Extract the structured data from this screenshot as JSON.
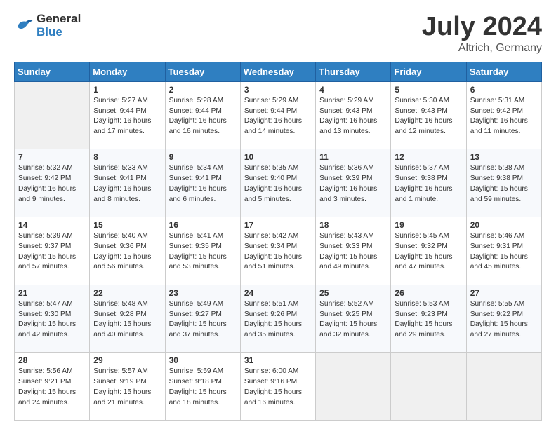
{
  "header": {
    "logo_line1": "General",
    "logo_line2": "Blue",
    "month": "July 2024",
    "location": "Altrich, Germany"
  },
  "days_of_week": [
    "Sunday",
    "Monday",
    "Tuesday",
    "Wednesday",
    "Thursday",
    "Friday",
    "Saturday"
  ],
  "weeks": [
    [
      {
        "day": "",
        "empty": true
      },
      {
        "day": "1",
        "sunrise": "Sunrise: 5:27 AM",
        "sunset": "Sunset: 9:44 PM",
        "daylight": "Daylight: 16 hours and 17 minutes."
      },
      {
        "day": "2",
        "sunrise": "Sunrise: 5:28 AM",
        "sunset": "Sunset: 9:44 PM",
        "daylight": "Daylight: 16 hours and 16 minutes."
      },
      {
        "day": "3",
        "sunrise": "Sunrise: 5:29 AM",
        "sunset": "Sunset: 9:44 PM",
        "daylight": "Daylight: 16 hours and 14 minutes."
      },
      {
        "day": "4",
        "sunrise": "Sunrise: 5:29 AM",
        "sunset": "Sunset: 9:43 PM",
        "daylight": "Daylight: 16 hours and 13 minutes."
      },
      {
        "day": "5",
        "sunrise": "Sunrise: 5:30 AM",
        "sunset": "Sunset: 9:43 PM",
        "daylight": "Daylight: 16 hours and 12 minutes."
      },
      {
        "day": "6",
        "sunrise": "Sunrise: 5:31 AM",
        "sunset": "Sunset: 9:42 PM",
        "daylight": "Daylight: 16 hours and 11 minutes."
      }
    ],
    [
      {
        "day": "7",
        "sunrise": "Sunrise: 5:32 AM",
        "sunset": "Sunset: 9:42 PM",
        "daylight": "Daylight: 16 hours and 9 minutes."
      },
      {
        "day": "8",
        "sunrise": "Sunrise: 5:33 AM",
        "sunset": "Sunset: 9:41 PM",
        "daylight": "Daylight: 16 hours and 8 minutes."
      },
      {
        "day": "9",
        "sunrise": "Sunrise: 5:34 AM",
        "sunset": "Sunset: 9:41 PM",
        "daylight": "Daylight: 16 hours and 6 minutes."
      },
      {
        "day": "10",
        "sunrise": "Sunrise: 5:35 AM",
        "sunset": "Sunset: 9:40 PM",
        "daylight": "Daylight: 16 hours and 5 minutes."
      },
      {
        "day": "11",
        "sunrise": "Sunrise: 5:36 AM",
        "sunset": "Sunset: 9:39 PM",
        "daylight": "Daylight: 16 hours and 3 minutes."
      },
      {
        "day": "12",
        "sunrise": "Sunrise: 5:37 AM",
        "sunset": "Sunset: 9:38 PM",
        "daylight": "Daylight: 16 hours and 1 minute."
      },
      {
        "day": "13",
        "sunrise": "Sunrise: 5:38 AM",
        "sunset": "Sunset: 9:38 PM",
        "daylight": "Daylight: 15 hours and 59 minutes."
      }
    ],
    [
      {
        "day": "14",
        "sunrise": "Sunrise: 5:39 AM",
        "sunset": "Sunset: 9:37 PM",
        "daylight": "Daylight: 15 hours and 57 minutes."
      },
      {
        "day": "15",
        "sunrise": "Sunrise: 5:40 AM",
        "sunset": "Sunset: 9:36 PM",
        "daylight": "Daylight: 15 hours and 56 minutes."
      },
      {
        "day": "16",
        "sunrise": "Sunrise: 5:41 AM",
        "sunset": "Sunset: 9:35 PM",
        "daylight": "Daylight: 15 hours and 53 minutes."
      },
      {
        "day": "17",
        "sunrise": "Sunrise: 5:42 AM",
        "sunset": "Sunset: 9:34 PM",
        "daylight": "Daylight: 15 hours and 51 minutes."
      },
      {
        "day": "18",
        "sunrise": "Sunrise: 5:43 AM",
        "sunset": "Sunset: 9:33 PM",
        "daylight": "Daylight: 15 hours and 49 minutes."
      },
      {
        "day": "19",
        "sunrise": "Sunrise: 5:45 AM",
        "sunset": "Sunset: 9:32 PM",
        "daylight": "Daylight: 15 hours and 47 minutes."
      },
      {
        "day": "20",
        "sunrise": "Sunrise: 5:46 AM",
        "sunset": "Sunset: 9:31 PM",
        "daylight": "Daylight: 15 hours and 45 minutes."
      }
    ],
    [
      {
        "day": "21",
        "sunrise": "Sunrise: 5:47 AM",
        "sunset": "Sunset: 9:30 PM",
        "daylight": "Daylight: 15 hours and 42 minutes."
      },
      {
        "day": "22",
        "sunrise": "Sunrise: 5:48 AM",
        "sunset": "Sunset: 9:28 PM",
        "daylight": "Daylight: 15 hours and 40 minutes."
      },
      {
        "day": "23",
        "sunrise": "Sunrise: 5:49 AM",
        "sunset": "Sunset: 9:27 PM",
        "daylight": "Daylight: 15 hours and 37 minutes."
      },
      {
        "day": "24",
        "sunrise": "Sunrise: 5:51 AM",
        "sunset": "Sunset: 9:26 PM",
        "daylight": "Daylight: 15 hours and 35 minutes."
      },
      {
        "day": "25",
        "sunrise": "Sunrise: 5:52 AM",
        "sunset": "Sunset: 9:25 PM",
        "daylight": "Daylight: 15 hours and 32 minutes."
      },
      {
        "day": "26",
        "sunrise": "Sunrise: 5:53 AM",
        "sunset": "Sunset: 9:23 PM",
        "daylight": "Daylight: 15 hours and 29 minutes."
      },
      {
        "day": "27",
        "sunrise": "Sunrise: 5:55 AM",
        "sunset": "Sunset: 9:22 PM",
        "daylight": "Daylight: 15 hours and 27 minutes."
      }
    ],
    [
      {
        "day": "28",
        "sunrise": "Sunrise: 5:56 AM",
        "sunset": "Sunset: 9:21 PM",
        "daylight": "Daylight: 15 hours and 24 minutes."
      },
      {
        "day": "29",
        "sunrise": "Sunrise: 5:57 AM",
        "sunset": "Sunset: 9:19 PM",
        "daylight": "Daylight: 15 hours and 21 minutes."
      },
      {
        "day": "30",
        "sunrise": "Sunrise: 5:59 AM",
        "sunset": "Sunset: 9:18 PM",
        "daylight": "Daylight: 15 hours and 18 minutes."
      },
      {
        "day": "31",
        "sunrise": "Sunrise: 6:00 AM",
        "sunset": "Sunset: 9:16 PM",
        "daylight": "Daylight: 15 hours and 16 minutes."
      },
      {
        "day": "",
        "empty": true
      },
      {
        "day": "",
        "empty": true
      },
      {
        "day": "",
        "empty": true
      }
    ]
  ]
}
